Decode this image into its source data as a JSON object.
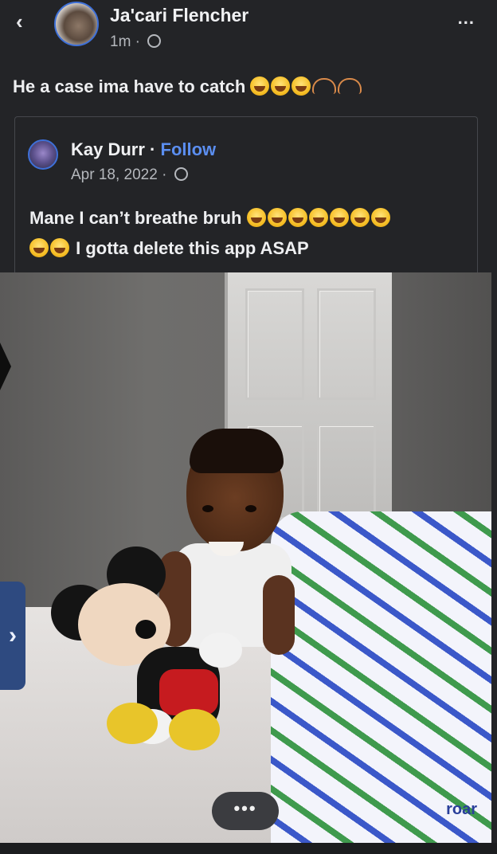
{
  "header": {
    "back_glyph": "‹",
    "author_name": "Ja'cari Flencher",
    "time_ago": "1m ·",
    "more_label": "..."
  },
  "post": {
    "text": "He a case ima have to catch",
    "emoji_laughing_count": 3,
    "emoji_hands_count": 2
  },
  "shared_post": {
    "author_name": "Kay Durr",
    "follow_label": "Follow",
    "separator": "·",
    "date": "Apr 18, 2022 ·",
    "text_line1": "Mane I can’t breathe bruh",
    "text_line2": "I gotta delete this app ASAP",
    "emoji_line1_count": 7,
    "emoji_line2_count": 2
  },
  "photo": {
    "blanket_print_text": "roar"
  },
  "controls": {
    "side_tab_glyph": "›",
    "more_pill_label": "•••"
  },
  "colors": {
    "background": "#232427",
    "link_blue": "#5b8ef0",
    "avatar_ring": "#3e70d8",
    "side_tab": "#2e4a80"
  }
}
